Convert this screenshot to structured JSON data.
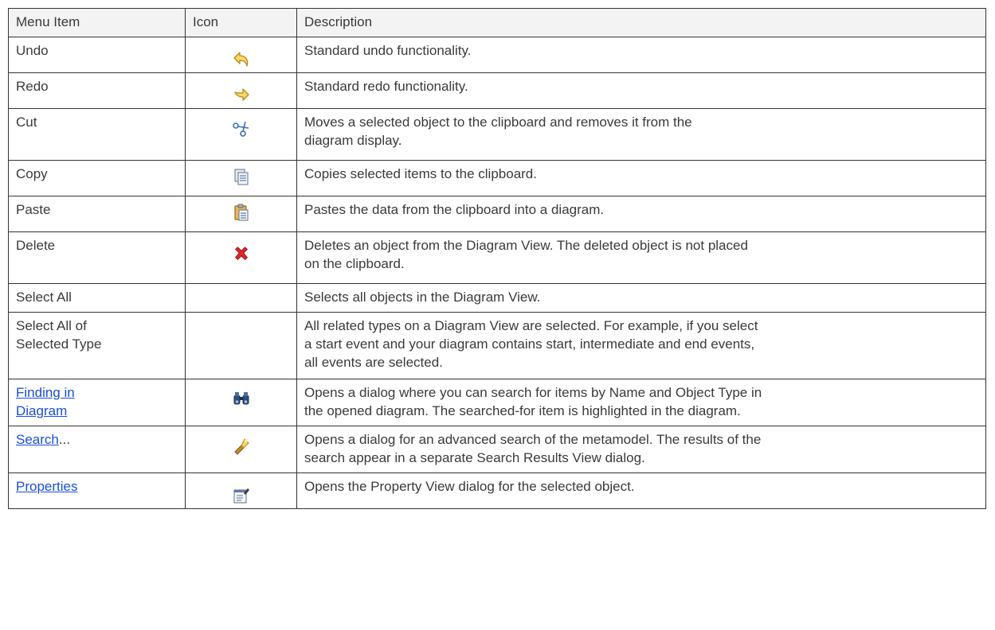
{
  "headers": {
    "menu_item": "Menu Item",
    "icon": "Icon",
    "description": "Description"
  },
  "rows": [
    {
      "item": "Undo",
      "icon": "undo-arrow-icon",
      "desc": [
        "Standard undo functionality."
      ]
    },
    {
      "item": "Redo",
      "icon": "redo-arrow-icon",
      "desc": [
        "Standard redo functionality."
      ]
    },
    {
      "item": "Cut",
      "icon": "scissors-icon",
      "desc": [
        "Moves a selected object to the clipboard and removes it from the",
        "diagram display."
      ]
    },
    {
      "item": "Copy",
      "icon": "copy-pages-icon",
      "desc": [
        "Copies selected items to the clipboard."
      ]
    },
    {
      "item": "Paste",
      "icon": "clipboard-paste-icon",
      "desc": [
        "Pastes the data from the clipboard into a diagram."
      ]
    },
    {
      "item": "Delete",
      "icon": "red-x-delete-icon",
      "desc": [
        "Deletes an object from the Diagram View. The deleted object is not placed",
        "on the clipboard."
      ]
    },
    {
      "item": "Select All",
      "icon": "",
      "desc": [
        "Selects all objects in the Diagram View."
      ]
    },
    {
      "item_lines": [
        "Select All of",
        "Selected Type"
      ],
      "icon": "",
      "desc": [
        "All related types on a Diagram View are selected. For example, if you select",
        "a start event and your diagram contains start, intermediate and end events,",
        "all events are selected."
      ]
    },
    {
      "item_lines": [
        "Finding in",
        "Diagram"
      ],
      "icon": "binoculars-icon",
      "desc": [
        "Opens a dialog where you can search for items by Name and Object Type in",
        "the opened diagram. The searched-for item is highlighted in the diagram."
      ]
    },
    {
      "item_link": "Search",
      "item_suffix": "...",
      "icon": "flashlight-search-icon",
      "desc": [
        "Opens a dialog for an advanced search of the metamodel. The results of the",
        "search appear in a separate Search Results View dialog."
      ]
    },
    {
      "item_link": "Properties",
      "icon": "properties-sheet-icon",
      "desc": [
        "Opens the Property View dialog for the selected object."
      ]
    }
  ],
  "colors": {
    "link": "#1a4ed8",
    "border": "#333333",
    "text": "#3a3a3a",
    "header_bg": "#f3f3f3"
  }
}
